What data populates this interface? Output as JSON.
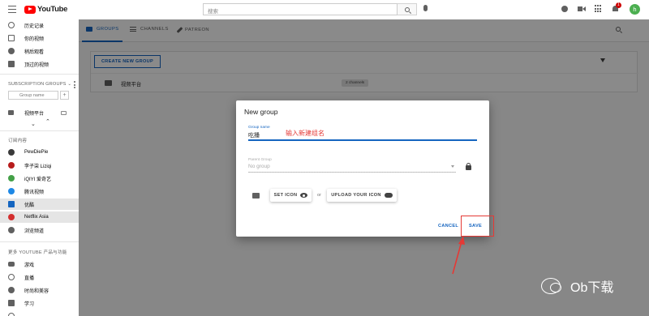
{
  "app": {
    "logo_text": "YouTube",
    "search_placeholder": "搜索",
    "notification_count": "1",
    "avatar_letter": "h"
  },
  "sidebar": {
    "items_top": [
      {
        "label": "历史记录",
        "icon": "history-icon"
      },
      {
        "label": "你的视频",
        "icon": "your-videos-icon"
      },
      {
        "label": "稍后观看",
        "icon": "watch-later-icon"
      },
      {
        "label": "顶过的视频",
        "icon": "thumb-up-icon"
      }
    ],
    "subscription_groups_title": "SUBSCRIPTION GROUPS",
    "group_name_placeholder": "Group name",
    "group_add": "+",
    "group_item": "视频平台",
    "subs_title": "订阅内容",
    "subscriptions": [
      {
        "label": "PewDiePie",
        "color": "#3a3a3a"
      },
      {
        "label": "李子柒 Liziqi",
        "color": "#b71c1c"
      },
      {
        "label": "iQIYI 爱奇艺",
        "color": "#43a047"
      },
      {
        "label": "腾讯视频",
        "color": "#1e88e5"
      },
      {
        "label": "优酷",
        "color": "#1565c0"
      },
      {
        "label": "Netflix Asia",
        "color": "#d32f2f"
      },
      {
        "label": "浏览频道",
        "color": "#606060"
      }
    ],
    "more_title": "更多 YOUTUBE 产品与功能",
    "more_items": [
      {
        "label": "游戏",
        "icon": "gaming-icon"
      },
      {
        "label": "直播",
        "icon": "live-icon"
      },
      {
        "label": "时尚和美容",
        "icon": "fashion-icon"
      },
      {
        "label": "学习",
        "icon": "learning-icon"
      }
    ]
  },
  "tabs": [
    {
      "label": "GROUPS",
      "icon": "folder-icon"
    },
    {
      "label": "CHANNELS",
      "icon": "list-icon"
    },
    {
      "label": "PATREON",
      "icon": "brush-icon"
    }
  ],
  "groups_page": {
    "create_button": "CREATE NEW GROUP",
    "group_name": "视频平台",
    "group_chip": "2 channels"
  },
  "dialog": {
    "title": "New group",
    "group_name_label": "Group name",
    "group_name_value": "吃播",
    "annotation": "输入新建组名",
    "parent_group_label": "Parent Group",
    "parent_group_value": "No group",
    "set_icon": "SET ICON",
    "or": "or",
    "upload_icon": "UPLOAD YOUR ICON",
    "cancel": "CANCEL",
    "save": "SAVE"
  },
  "watermark": "Ob下载",
  "colors": {
    "accent": "#1565c0",
    "annotation": "#e53935",
    "brand": "#ff0000"
  }
}
